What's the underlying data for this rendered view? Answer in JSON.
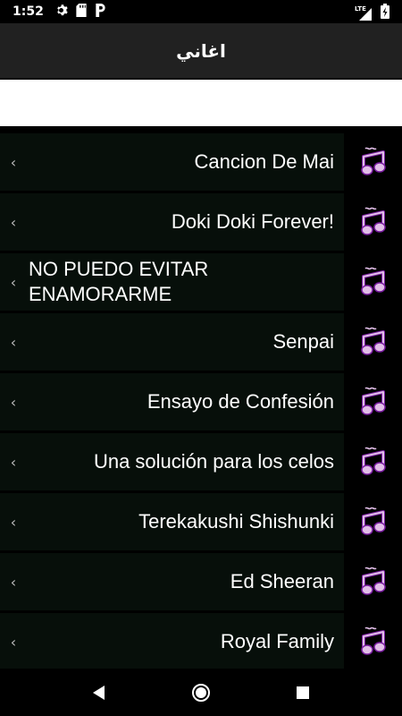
{
  "status_bar": {
    "time": "1:52",
    "network": "LTE",
    "left_icons": [
      "gear-icon",
      "sd-card-icon",
      "parking-icon"
    ],
    "right_icons": [
      "signal-icon",
      "battery-icon"
    ]
  },
  "toolbar": {
    "title": "اغاني"
  },
  "search": {
    "placeholder": "",
    "value": ""
  },
  "songs": [
    {
      "title": "Cancion De Mai"
    },
    {
      "title": "Doki Doki Forever!"
    },
    {
      "title": "NO PUEDO EVITAR ENAMORARME"
    },
    {
      "title": "Senpai"
    },
    {
      "title": "Ensayo de Confesión"
    },
    {
      "title": "Una solución para los celos"
    },
    {
      "title": "Terekakushi Shishunki"
    },
    {
      "title": "Ed Sheeran"
    },
    {
      "title": "Royal Family"
    }
  ],
  "colors": {
    "toolbar_bg": "#212121",
    "row_bg": "#070f0a",
    "note_fill": "#e1bee7",
    "note_stroke": "#7b1fa2"
  },
  "nav_bar": {
    "buttons": [
      "back-icon",
      "home-icon",
      "recents-icon"
    ]
  }
}
